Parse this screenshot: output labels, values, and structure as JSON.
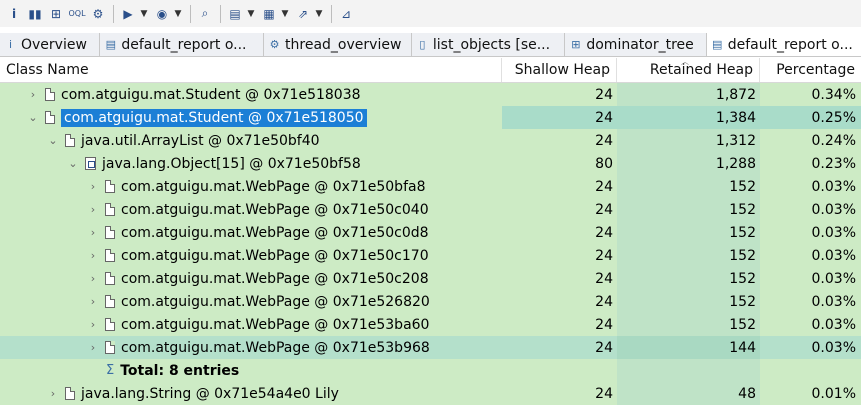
{
  "toolbar": {
    "icons": [
      "info-icon",
      "histogram-icon",
      "dominator-tree-icon",
      "oql-icon",
      "heap-dump-overview-icon",
      "run-report-icon",
      "query-browser-icon",
      "search-icon",
      "group-by-icon",
      "calculate-retained-icon",
      "export-icon",
      "pin-icon"
    ]
  },
  "tabs": [
    {
      "label": "Overview",
      "icon": "info-icon",
      "glyph": "i"
    },
    {
      "label": "default_report  o...",
      "icon": "report-icon",
      "glyph": "▤"
    },
    {
      "label": "thread_overview",
      "icon": "gear-icon",
      "glyph": "⚙"
    },
    {
      "label": "list_objects  [se...",
      "icon": "list-icon",
      "glyph": "▯"
    },
    {
      "label": "dominator_tree",
      "icon": "tree-icon",
      "glyph": "⊞"
    },
    {
      "label": "default_report  o...",
      "icon": "report-icon",
      "glyph": "▤"
    }
  ],
  "columns": {
    "class_name": "Class Name",
    "shallow_heap": "Shallow Heap",
    "retained_heap": "Retained Heap",
    "percentage": "Percentage"
  },
  "rows": [
    {
      "name": "com.atguigu.mat.Student @ 0x71e518038",
      "shallow": "24",
      "retained": "1,872",
      "pct": "0.34%"
    },
    {
      "name": "com.atguigu.mat.Student @ 0x71e518050",
      "shallow": "24",
      "retained": "1,384",
      "pct": "0.25%"
    },
    {
      "name": "java.util.ArrayList @ 0x71e50bf40",
      "shallow": "24",
      "retained": "1,312",
      "pct": "0.24%"
    },
    {
      "name": "java.lang.Object[15] @ 0x71e50bf58",
      "shallow": "80",
      "retained": "1,288",
      "pct": "0.23%"
    },
    {
      "name": "com.atguigu.mat.WebPage @ 0x71e50bfa8",
      "shallow": "24",
      "retained": "152",
      "pct": "0.03%"
    },
    {
      "name": "com.atguigu.mat.WebPage @ 0x71e50c040",
      "shallow": "24",
      "retained": "152",
      "pct": "0.03%"
    },
    {
      "name": "com.atguigu.mat.WebPage @ 0x71e50c0d8",
      "shallow": "24",
      "retained": "152",
      "pct": "0.03%"
    },
    {
      "name": "com.atguigu.mat.WebPage @ 0x71e50c170",
      "shallow": "24",
      "retained": "152",
      "pct": "0.03%"
    },
    {
      "name": "com.atguigu.mat.WebPage @ 0x71e50c208",
      "shallow": "24",
      "retained": "152",
      "pct": "0.03%"
    },
    {
      "name": "com.atguigu.mat.WebPage @ 0x71e526820",
      "shallow": "24",
      "retained": "152",
      "pct": "0.03%"
    },
    {
      "name": "com.atguigu.mat.WebPage @ 0x71e53ba60",
      "shallow": "24",
      "retained": "152",
      "pct": "0.03%"
    },
    {
      "name": "com.atguigu.mat.WebPage @ 0x71e53b968",
      "shallow": "24",
      "retained": "144",
      "pct": "0.03%"
    },
    {
      "name": "Total: 8 entries"
    },
    {
      "name": "java.lang.String @ 0x71e54a4e0  Lily",
      "shallow": "24",
      "retained": "48",
      "pct": "0.01%"
    }
  ],
  "colors": {
    "row_bg": "#cdebc5",
    "selection": "#1c7fd6",
    "highlight_row": "#b4e0cb"
  }
}
